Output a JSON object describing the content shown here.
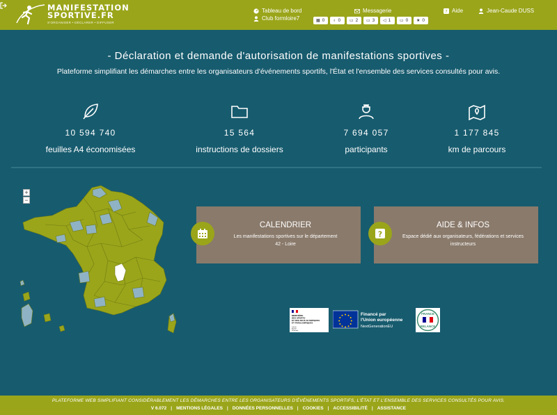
{
  "header": {
    "logo": {
      "line1": "MANIFESTATION",
      "line2": "SPORTIVE.FR",
      "tagline": "S'ORGANISER • DÉCLARER • DIFFUSER"
    },
    "nav": {
      "dashboard": "Tableau de bord",
      "club": "Club formloire7",
      "messages": "Messagerie",
      "help": "Aide",
      "user": "Jean-Caude DUSS"
    },
    "badges": [
      {
        "icon": "calendar-icon",
        "count": "0"
      },
      {
        "icon": "bicycle-icon",
        "count": "0"
      },
      {
        "icon": "comment-icon",
        "count": "2"
      },
      {
        "icon": "comment-icon",
        "count": "3"
      },
      {
        "icon": "bullhorn-icon",
        "count": "1"
      },
      {
        "icon": "comments-icon",
        "count": "0"
      },
      {
        "icon": "star-icon",
        "count": "0"
      }
    ]
  },
  "hero": {
    "title": "- Déclaration et demande d'autorisation de manifestations sportives -",
    "subtitle": "Plateforme simplifiant les démarches entre les organisateurs d'événements sportifs, l'État et l'ensemble des services consultés pour avis."
  },
  "stats": [
    {
      "icon": "leaf-icon",
      "value": "10 594 740",
      "label": "feuilles A4 économisées"
    },
    {
      "icon": "folder-icon",
      "value": "15 564",
      "label": "instructions de dossiers"
    },
    {
      "icon": "participant-icon",
      "value": "7 694 057",
      "label": "participants"
    },
    {
      "icon": "map-marker-icon",
      "value": "1 177 845",
      "label": "km de parcours"
    }
  ],
  "map": {
    "zoom_in": "+",
    "zoom_out": "−"
  },
  "cards": {
    "calendar": {
      "title": "CALENDRIER",
      "desc1": "Les manifestations sportives sur le département",
      "desc2": "42 - Loire"
    },
    "help": {
      "title": "AIDE & INFOS",
      "desc1": "Espace dédié aux organisateurs, fédérations et services instructeurs"
    }
  },
  "partners": {
    "ministere": "MINISTÈRE DES SPORTS ET DES JEUX OLYMPIQUES ET PARALYMPIQUES",
    "ministere_motto": "Liberté Égalité Fraternité",
    "eu_line1": "Financé par",
    "eu_line2": "l'Union européenne",
    "eu_line3": "NextGenerationEU",
    "relance": "FRANCE RELANCE"
  },
  "footer": {
    "tagline": "PLATEFORME WEB SIMPLIFIANT CONSIDÉRABLEMENT LES DÉMARCHES ENTRE LES ORGANISATEURS D'ÉVÉNEMENTS SPORTIFS, L'ÉTAT ET L'ENSEMBLE DES SERVICES CONSULTÉS POUR AVIS.",
    "version": "V 6.072",
    "links": [
      "MENTIONS LÉGALES",
      "DONNÉES PERSONNELLES",
      "COOKIES",
      "ACCESSIBILITÉ",
      "ASSISTANCE"
    ]
  },
  "colors": {
    "primary": "#175b6e",
    "accent": "#9aa51a",
    "card": "#8a7a6b",
    "map_light": "#8fb3c4",
    "selected": "#ffffff"
  }
}
